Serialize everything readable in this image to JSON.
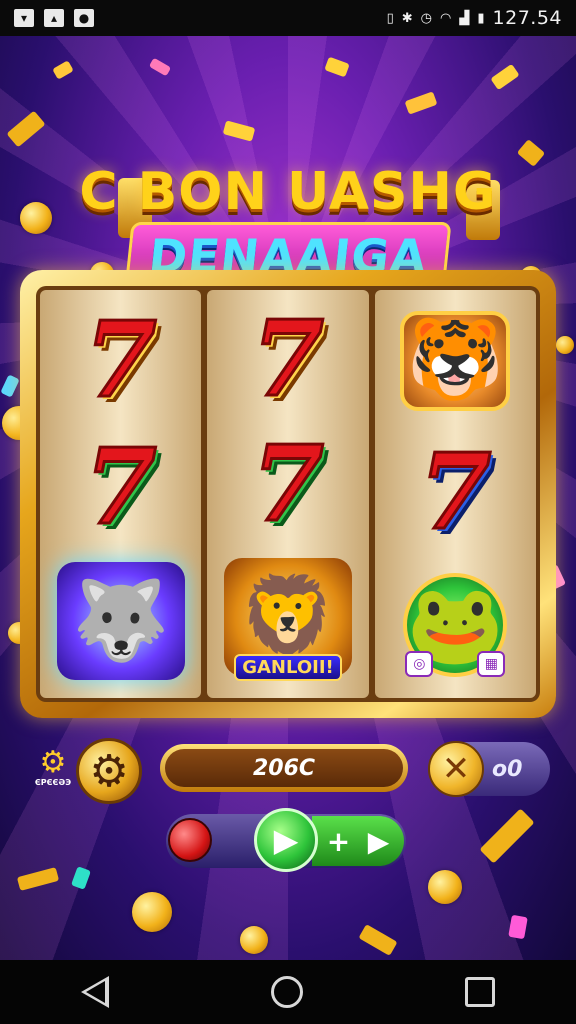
{
  "status_bar": {
    "left_icons": [
      "notification-icon-a",
      "notification-icon-b",
      "notification-icon-c"
    ],
    "right_icons": [
      "vibrate-icon",
      "bluetooth-icon",
      "alarm-icon",
      "wifi-icon",
      "signal-icon",
      "battery-icon"
    ],
    "time": "127.54"
  },
  "game": {
    "title_line1": "C BON UASHG",
    "title_line2": "DENAAIGA",
    "reels": [
      [
        {
          "type": "seven",
          "label": "7"
        },
        {
          "type": "seven",
          "label": "7"
        },
        {
          "type": "wolf-icon"
        }
      ],
      [
        {
          "type": "seven",
          "label": "7"
        },
        {
          "type": "seven",
          "label": "7"
        },
        {
          "type": "lion-icon",
          "tag": "GANLOII!"
        }
      ],
      [
        {
          "type": "tiger-icon"
        },
        {
          "type": "seven",
          "label": "7"
        },
        {
          "type": "frog-icon"
        }
      ]
    ],
    "settings_label": "ЄРЄЄӘЭ",
    "bet_value": "206C",
    "multiplier_value": "о0",
    "spin_plus": "+",
    "colors": {
      "accent_gold": "#e6a61c",
      "bg_purple": "#6a1fb0",
      "seven_red": "#e3161c",
      "spin_green": "#2ec43a"
    }
  },
  "nav": {
    "back": "back-icon",
    "home": "home-icon",
    "recents": "recents-icon"
  }
}
